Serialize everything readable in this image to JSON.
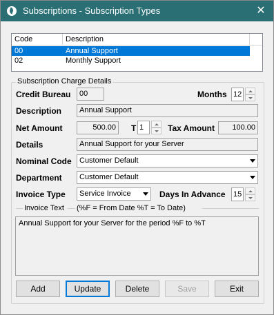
{
  "window": {
    "title": "Subscriptions - Subscription Types",
    "close_glyph": "✕"
  },
  "grid": {
    "columns": [
      "Code",
      "Description"
    ],
    "rows": [
      {
        "code": "00",
        "description": "Annual Support",
        "selected": true
      },
      {
        "code": "02",
        "description": "Monthly Support",
        "selected": false
      }
    ]
  },
  "group": {
    "title": "Subscription Charge Details"
  },
  "form": {
    "credit_bureau_label": "Credit Bureau",
    "credit_bureau_value": "00",
    "months_label": "Months",
    "months_value": "12",
    "description_label": "Description",
    "description_value": "Annual Support",
    "net_amount_label": "Net Amount",
    "net_amount_value": "500.00",
    "t_label": "T",
    "t_value": "1",
    "tax_amount_label": "Tax Amount",
    "tax_amount_value": "100.00",
    "details_label": "Details",
    "details_value": "Annual Support for your Server",
    "nominal_code_label": "Nominal Code",
    "nominal_code_value": "Customer Default",
    "department_label": "Department",
    "department_value": "Customer Default",
    "invoice_type_label": "Invoice Type",
    "invoice_type_value": "Service Invoice",
    "days_in_advance_label": "Days In Advance",
    "days_in_advance_value": "15",
    "invoice_text_label": "Invoice Text",
    "invoice_text_hint": "(%F = From Date  %T = To Date)",
    "invoice_text_value": "Annual Support for your Server for the period %F to %T"
  },
  "buttons": {
    "add": "Add",
    "update": "Update",
    "delete": "Delete",
    "save": "Save",
    "exit": "Exit"
  },
  "colors": {
    "titlebar": "#2a6f74",
    "selection": "#0078d7"
  }
}
